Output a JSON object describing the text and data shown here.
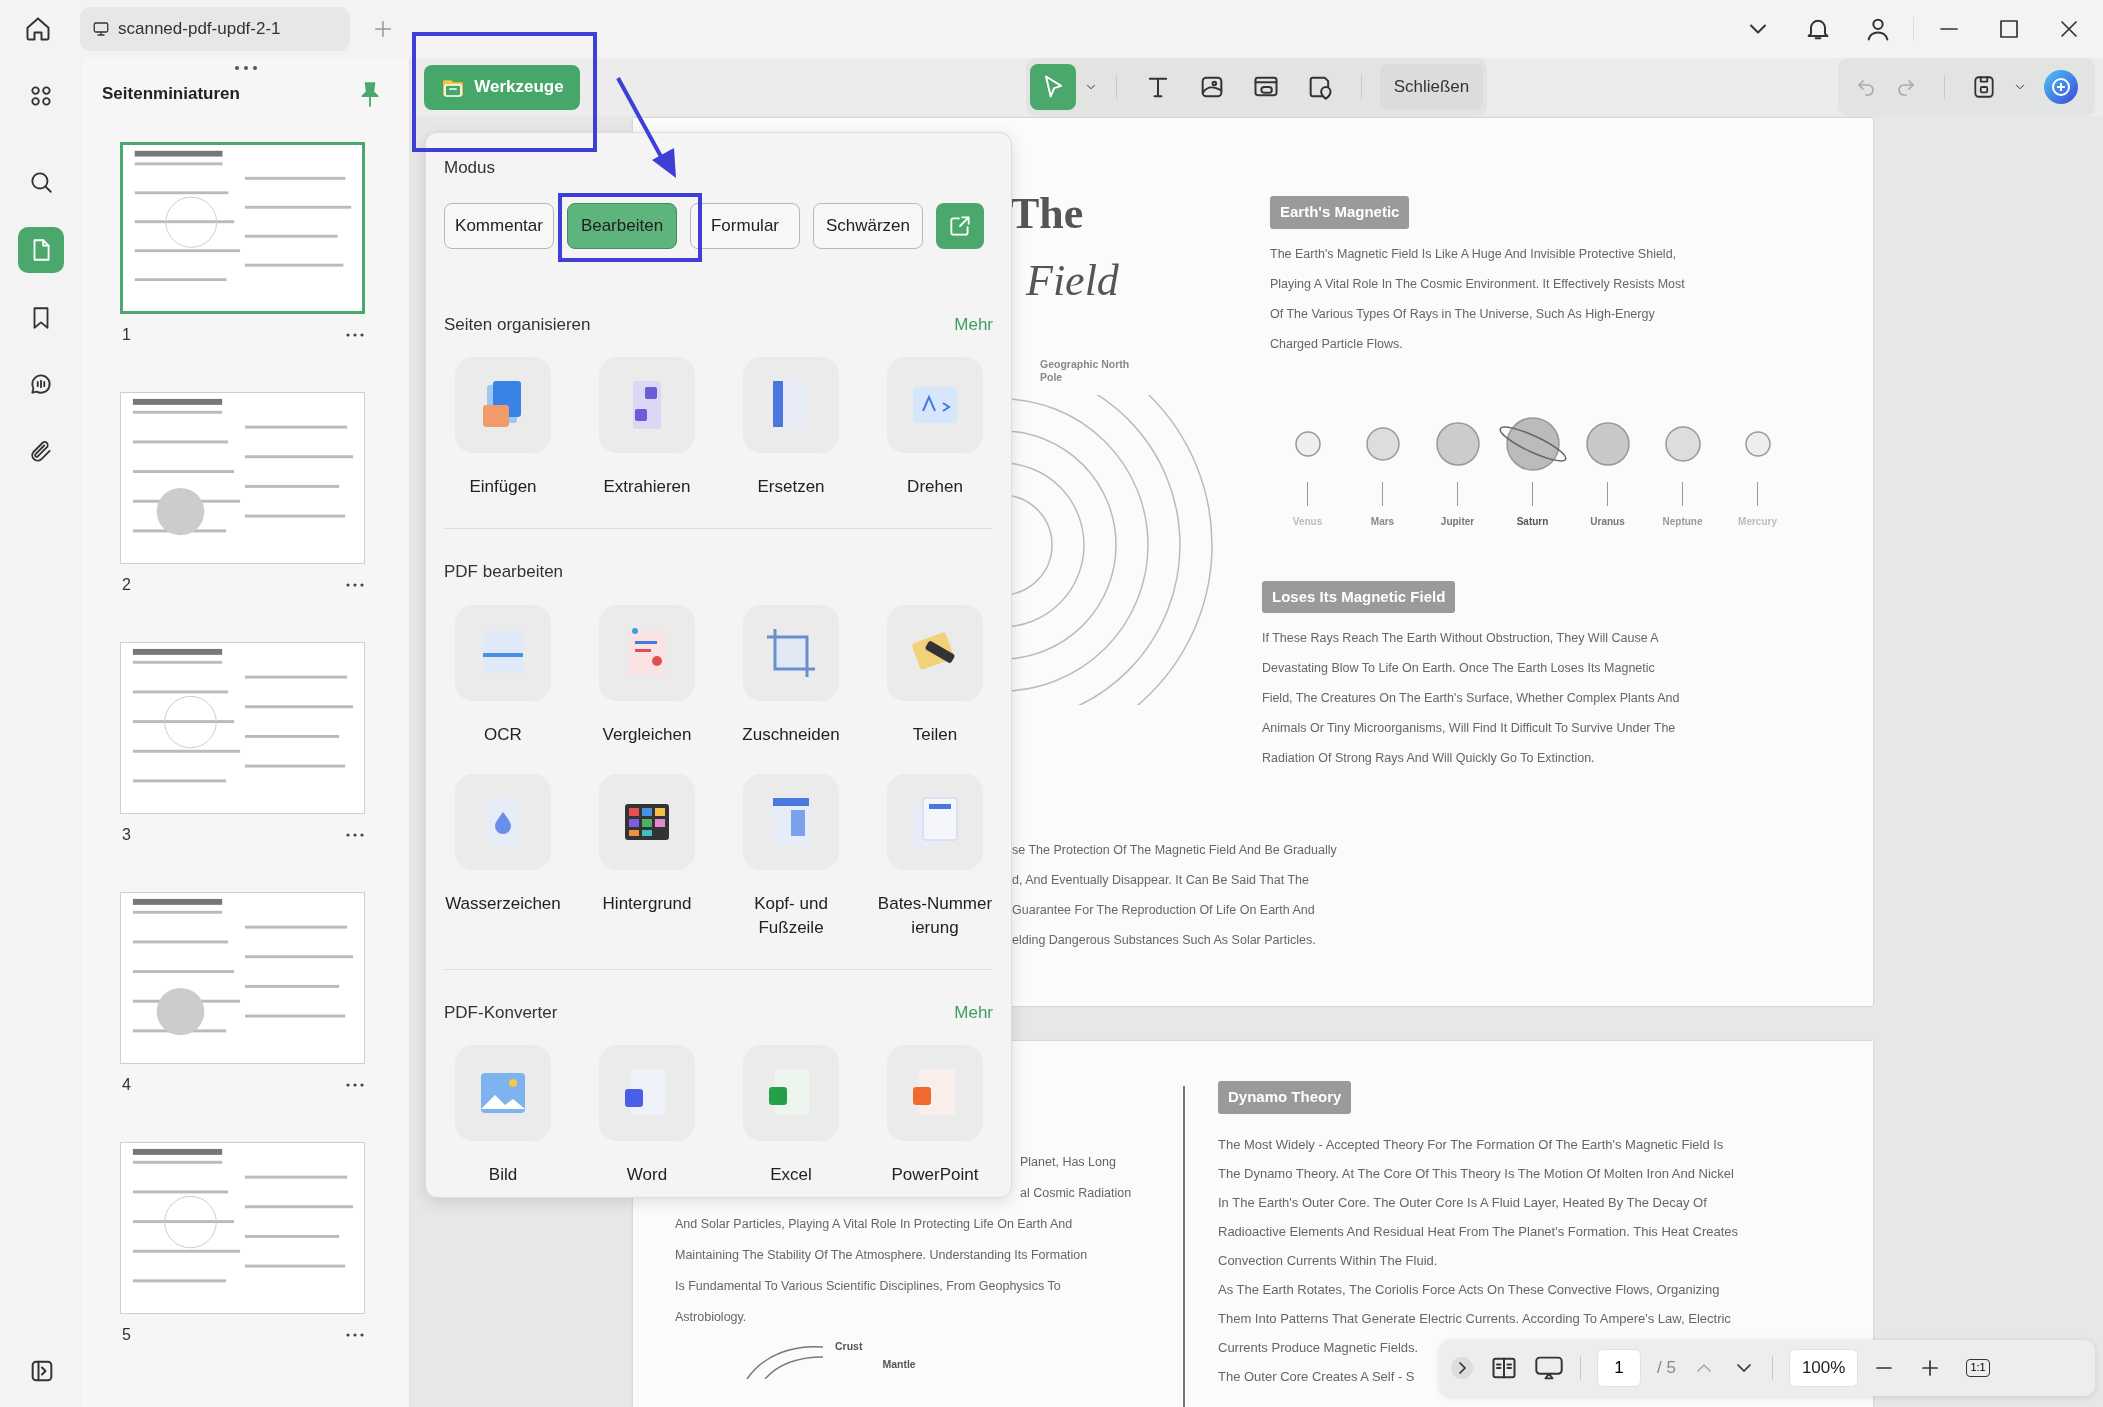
{
  "tab": {
    "title": "scanned-pdf-updf-2-1"
  },
  "rail": [
    {
      "kind": "apps",
      "selected": false
    },
    {
      "kind": "search",
      "selected": false
    },
    {
      "kind": "pages",
      "selected": true
    },
    {
      "kind": "bookmark",
      "selected": false
    },
    {
      "kind": "comment",
      "selected": false
    },
    {
      "kind": "attachment",
      "selected": false
    }
  ],
  "sidebar": {
    "title": "Seitenminiaturen",
    "pinned": true,
    "pages": [
      {
        "number": "1",
        "selected": true
      },
      {
        "number": "2",
        "selected": false
      },
      {
        "number": "3",
        "selected": false
      },
      {
        "number": "4",
        "selected": false
      },
      {
        "number": "5",
        "selected": false
      }
    ]
  },
  "toolbar": {
    "tools_button": "Werkzeuge",
    "tools": [
      {
        "kind": "select",
        "selected": true
      },
      {
        "kind": "text",
        "selected": false
      },
      {
        "kind": "image",
        "selected": false
      },
      {
        "kind": "link",
        "selected": false
      },
      {
        "kind": "stamp",
        "selected": false
      }
    ],
    "close_button": "Schließen"
  },
  "tools_menu": {
    "mode_title": "Modus",
    "modes": [
      {
        "label": "Kommentar",
        "selected": false
      },
      {
        "label": "Bearbeiten",
        "selected": true
      },
      {
        "label": "Formular",
        "selected": false
      },
      {
        "label": "Schwärzen",
        "selected": false
      }
    ],
    "sections": [
      {
        "title": "Seiten organisieren",
        "more": "Mehr",
        "items": [
          {
            "label": "Einfügen",
            "kind": "insert"
          },
          {
            "label": "Extrahieren",
            "kind": "extract"
          },
          {
            "label": "Ersetzen",
            "kind": "replace"
          },
          {
            "label": "Drehen",
            "kind": "rotate"
          }
        ]
      },
      {
        "title": "PDF bearbeiten",
        "items": [
          {
            "label": "OCR",
            "kind": "ocr"
          },
          {
            "label": "Vergleichen",
            "kind": "compare"
          },
          {
            "label": "Zuschneiden",
            "kind": "crop"
          },
          {
            "label": "Teilen",
            "kind": "split"
          },
          {
            "label": "Wasserzeichen",
            "kind": "watermark"
          },
          {
            "label": "Hintergrund",
            "kind": "background"
          },
          {
            "label": "Kopf- und Fußzeile",
            "kind": "header_footer"
          },
          {
            "label": "Bates-Nummerierung",
            "kind": "bates"
          }
        ]
      },
      {
        "title": "PDF-Konverter",
        "more": "Mehr",
        "items": [
          {
            "label": "Bild",
            "kind": "image"
          },
          {
            "label": "Word",
            "kind": "word"
          },
          {
            "label": "Excel",
            "kind": "excel"
          },
          {
            "label": "PowerPoint",
            "kind": "powerpoint"
          }
        ]
      }
    ]
  },
  "document": {
    "page_1": {
      "title_lines": [
        "The",
        "Field"
      ],
      "pole_label": "Geographic North Pole",
      "sections": [
        {
          "heading": "Earth's Magnetic",
          "lines": [
            "The Earth's Magnetic Field Is Like A Huge And Invisible Protective Shield,",
            "Playing A Vital Role In The Cosmic Environment. It Effectively Resists Most",
            "Of The Various Types Of Rays in The Universe, Such As High-Energy",
            "Charged Particle Flows."
          ]
        },
        {
          "heading": "Loses Its Magnetic Field",
          "lines": [
            "If These Rays Reach The Earth Without Obstruction, They Will Cause A",
            "Devastating Blow To Life On Earth. Once The Earth Loses Its Magnetic",
            "Field, The Creatures On The Earth's Surface, Whether Complex Plants And",
            "Animals Or Tiny Microorganisms, Will Find It Difficult To Survive Under The",
            "Radiation Of Strong Rays And Will Quickly Go To Extinction."
          ]
        }
      ],
      "planets": [
        {
          "name": "Venus",
          "ringed": false
        },
        {
          "name": "Mars",
          "ringed": false
        },
        {
          "name": "Jupiter",
          "ringed": false
        },
        {
          "name": "Saturn",
          "ringed": true
        },
        {
          "name": "Uranus",
          "ringed": false
        },
        {
          "name": "Neptune",
          "ringed": false
        },
        {
          "name": "Mercury",
          "ringed": false
        }
      ],
      "cut_lines": [
        "se The Protection Of The Magnetic Field And Be Gradually",
        "d, And Eventually Disappear. It Can Be Said That The",
        "Guarantee For The Reproduction Of Life On Earth And",
        "elding Dangerous Substances Such As Solar Particles."
      ]
    },
    "page_2": {
      "left_lines": [
        "Planet, Has Long",
        "al Cosmic Radiation",
        "And Solar Particles, Playing A Vital Role In Protecting Life On Earth And",
        "Maintaining The Stability Of The Atmosphere. Understanding Its Formation",
        "Is Fundamental To Various Scientific Disciplines, From Geophysics To",
        "Astrobiology."
      ],
      "diagram_labels": [
        "Crust",
        "Mantle"
      ],
      "section": {
        "heading": "Dynamo Theory",
        "lines": [
          "The Most Widely - Accepted Theory For The Formation Of The Earth's Magnetic Field Is",
          "The Dynamo Theory. At The Core Of This Theory Is The Motion Of Molten Iron And Nickel",
          "In The Earth's Outer Core. The Outer Core Is A Fluid Layer, Heated By The Decay Of",
          "Radioactive Elements And Residual Heat From The Planet's Formation. This Heat Creates",
          "Convection Currents Within The Fluid.",
          "As The Earth Rotates, The Coriolis Force Acts On These Convective Flows, Organizing",
          "Them Into Patterns That Generate Electric Currents. According To Ampere's Law, Electric",
          "Currents Produce Magnetic Fields.",
          "The Outer Core Creates A Self - S"
        ]
      }
    }
  },
  "page_nav": {
    "page": "1",
    "total": "/ 5",
    "zoom": "100%",
    "actual_size": "1:1"
  }
}
